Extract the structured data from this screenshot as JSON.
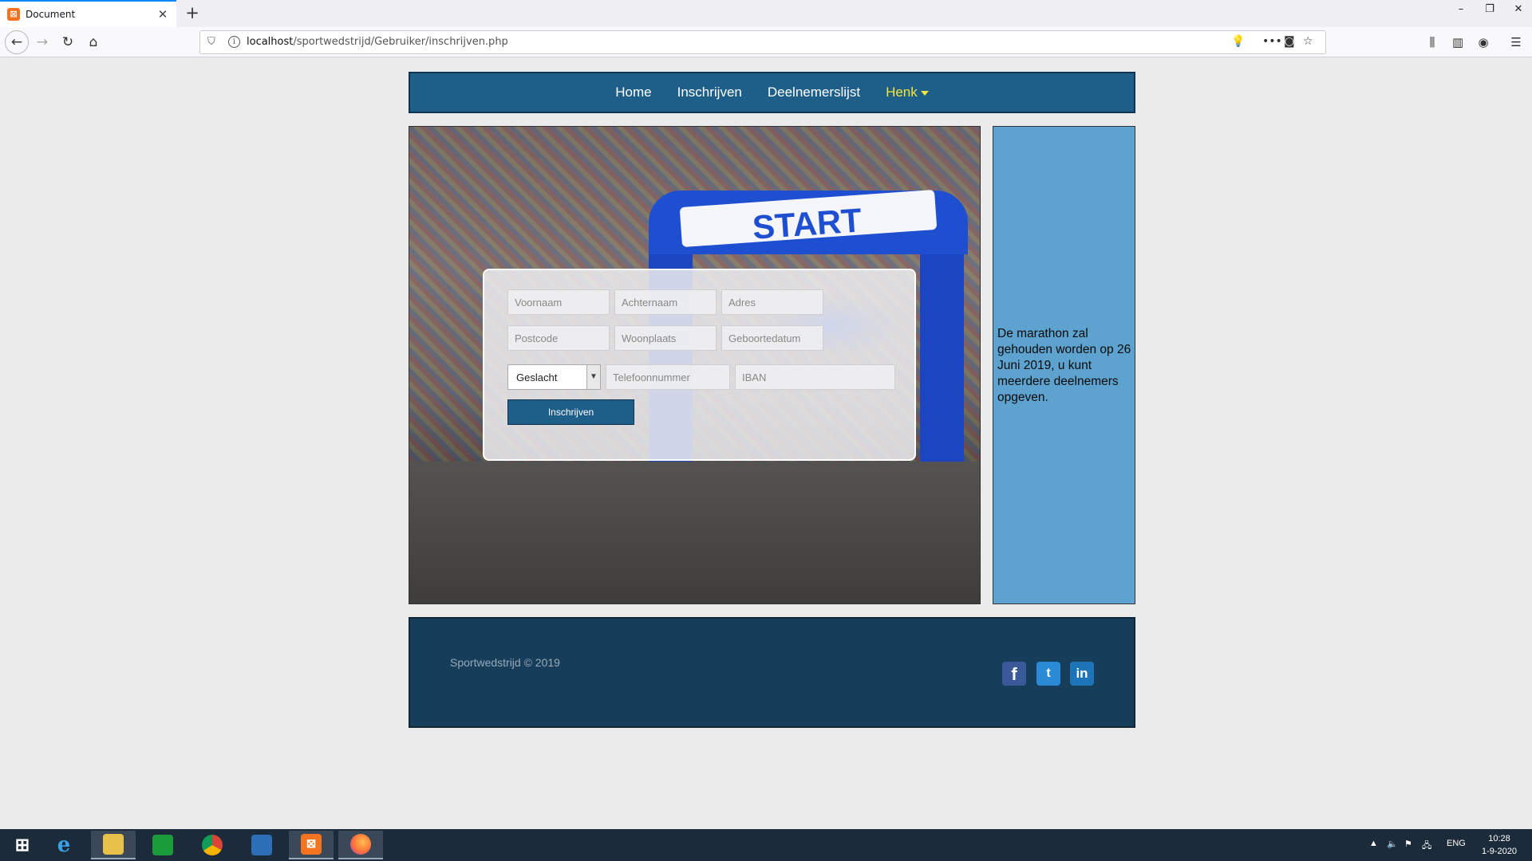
{
  "browser": {
    "tab_title": "Document",
    "url_host": "localhost",
    "url_path": "/sportwedstrijd/Gebruiker/inschrijven.php"
  },
  "nav": {
    "items": [
      "Home",
      "Inschrijven",
      "Deelnemerslijst"
    ],
    "user": "Henk"
  },
  "form": {
    "fields": {
      "voornaam": "Voornaam",
      "achternaam": "Achternaam",
      "adres": "Adres",
      "postcode": "Postcode",
      "woonplaats": "Woonplaats",
      "geboortedatum": "Geboortedatum",
      "telefoonnummer": "Telefoonnummer",
      "iban": "IBAN"
    },
    "gender_select": "Geslacht",
    "submit_label": "Inschrijven"
  },
  "hero": {
    "banner_text": "START"
  },
  "sidebar": {
    "text": "De marathon zal gehouden worden op 26 Juni 2019, u kunt meerdere deelnemers opgeven."
  },
  "footer": {
    "copyright": "Sportwedstrijd © 2019",
    "social": [
      "f",
      "t",
      "in"
    ]
  },
  "taskbar": {
    "language": "ENG",
    "time": "10:28",
    "date": "1-9-2020"
  },
  "colors": {
    "nav_bg": "#1e5f89",
    "footer_bg": "#163e5b",
    "sidebar_bg": "#5ea3cf",
    "user_accent": "#f5e43c"
  }
}
